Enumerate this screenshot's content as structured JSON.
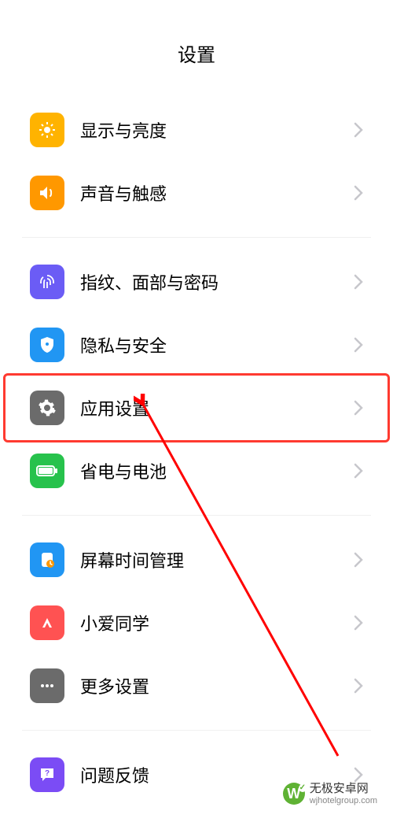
{
  "title": "设置",
  "groups": [
    {
      "items": [
        {
          "id": "display",
          "label": "显示与亮度",
          "icon": "brightness-icon",
          "bg": "#ffb300"
        },
        {
          "id": "sound",
          "label": "声音与触感",
          "icon": "sound-icon",
          "bg": "#ff9800"
        }
      ]
    },
    {
      "items": [
        {
          "id": "biometrics",
          "label": "指纹、面部与密码",
          "icon": "fingerprint-icon",
          "bg": "#6b5cf5"
        },
        {
          "id": "privacy",
          "label": "隐私与安全",
          "icon": "shield-icon",
          "bg": "#2196f3"
        },
        {
          "id": "apps",
          "label": "应用设置",
          "icon": "gear-icon",
          "bg": "#6b6b6b",
          "highlighted": true
        },
        {
          "id": "battery",
          "label": "省电与电池",
          "icon": "battery-icon",
          "bg": "#27c24c"
        }
      ]
    },
    {
      "items": [
        {
          "id": "screentime",
          "label": "屏幕时间管理",
          "icon": "screentime-icon",
          "bg": "#2196f3"
        },
        {
          "id": "xiaoai",
          "label": "小爱同学",
          "icon": "xiaoai-icon",
          "bg": "#ff5252"
        },
        {
          "id": "more",
          "label": "更多设置",
          "icon": "more-icon",
          "bg": "#6b6b6b"
        }
      ]
    },
    {
      "items": [
        {
          "id": "feedback",
          "label": "问题反馈",
          "icon": "feedback-icon",
          "bg": "#7b4cf5"
        }
      ]
    }
  ],
  "watermark": {
    "brand": "无极安卓网",
    "url": "wjhotelgroup.com",
    "logo": "W"
  }
}
